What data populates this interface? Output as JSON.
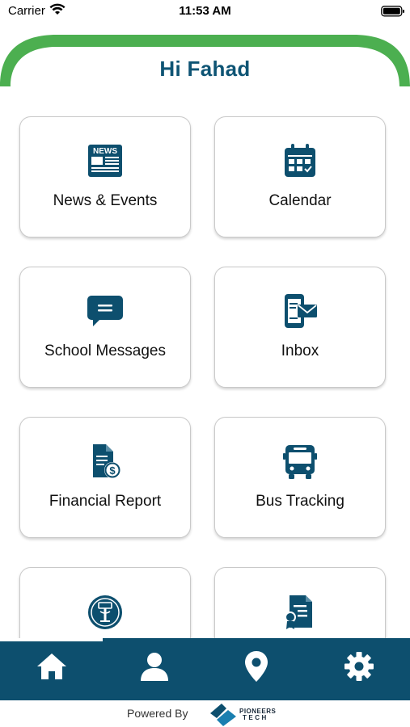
{
  "status_bar": {
    "carrier": "Carrier",
    "time": "11:53 AM"
  },
  "greeting": "Hi Fahad",
  "tiles": [
    {
      "label": "News & Events",
      "icon": "newspaper-icon",
      "icon_text": "NEWS"
    },
    {
      "label": "Calendar",
      "icon": "calendar-icon"
    },
    {
      "label": "School Messages",
      "icon": "chat-bubble-icon"
    },
    {
      "label": "Inbox",
      "icon": "mobile-mail-icon"
    },
    {
      "label": "Financial Report",
      "icon": "invoice-dollar-icon"
    },
    {
      "label": "Bus Tracking",
      "icon": "bus-icon"
    },
    {
      "label": "",
      "icon": "school-emblem-icon"
    },
    {
      "label": "",
      "icon": "certificate-icon"
    }
  ],
  "bottom_nav": [
    {
      "icon": "home-icon",
      "active": true
    },
    {
      "icon": "user-icon",
      "active": false
    },
    {
      "icon": "location-pin-icon",
      "active": false
    },
    {
      "icon": "gear-icon",
      "active": false
    }
  ],
  "footer": {
    "powered_by": "Powered By",
    "logo_line1": "PIONEERS",
    "logo_line2": "TECH"
  },
  "colors": {
    "primary": "#0d4f6e",
    "accent_green": "#4caf50",
    "greeting": "#0e5474"
  }
}
